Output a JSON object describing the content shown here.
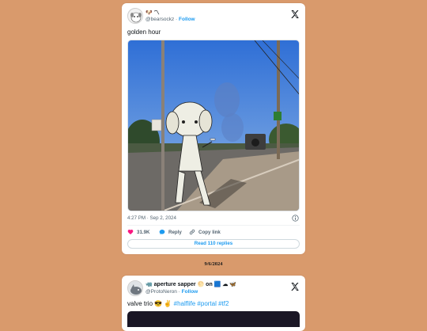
{
  "tweet1": {
    "display_name": "🐶 〽",
    "handle": "@bearsockz",
    "follow_label": "Follow",
    "text": "golden hour",
    "timestamp": "4:27 PM · Sep 2, 2024",
    "likes": "31.9K",
    "reply_label": "Reply",
    "copy_label": "Copy link",
    "read_replies": "Read 110 replies"
  },
  "date_caption": "9/6/2024",
  "tweet2": {
    "display_name": "🦏 aperture sapper 🌕 on 🟦 ☁ 🦋",
    "handle": "@ProtoNeron",
    "follow_label": "Follow",
    "text_prefix": "valve trio 😎 ✌",
    "hashtags": "#halflife #portal #tf2"
  },
  "colors": {
    "background": "#d99a6c",
    "accent": "#1d9bf0",
    "like": "#f91880"
  }
}
